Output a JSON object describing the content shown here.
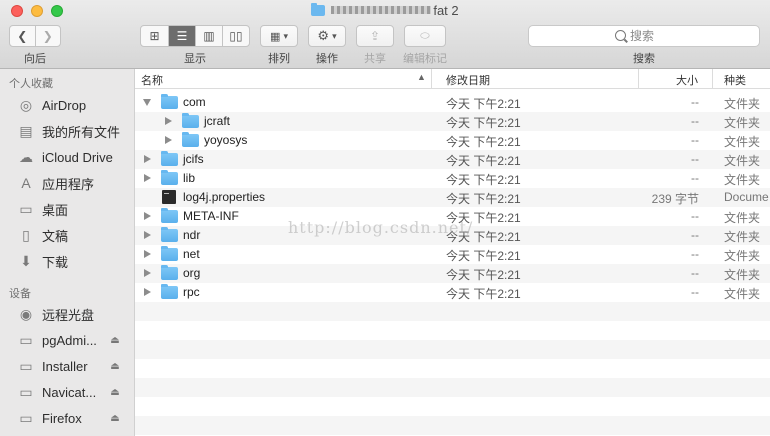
{
  "window": {
    "title": "fat 2"
  },
  "toolbar": {
    "back_forward_label": "向后",
    "view_label": "显示",
    "arrange_label": "排列",
    "action_label": "操作",
    "share_label": "共享",
    "tags_label": "编辑标记",
    "search_label": "搜索",
    "search_placeholder": "搜索"
  },
  "sidebar": {
    "favorites_heading": "个人收藏",
    "favorites": [
      {
        "label": "AirDrop",
        "icon": "airdrop-icon"
      },
      {
        "label": "我的所有文件",
        "icon": "all-files-icon"
      },
      {
        "label": "iCloud Drive",
        "icon": "cloud-icon"
      },
      {
        "label": "应用程序",
        "icon": "applications-icon"
      },
      {
        "label": "桌面",
        "icon": "desktop-icon"
      },
      {
        "label": "文稿",
        "icon": "documents-icon"
      },
      {
        "label": "下载",
        "icon": "download-icon"
      }
    ],
    "devices_heading": "设备",
    "devices": [
      {
        "label": "远程光盘",
        "icon": "remote-disc-icon"
      },
      {
        "label": "pgAdmi...",
        "icon": "drive-icon"
      },
      {
        "label": "Installer",
        "icon": "drive-icon"
      },
      {
        "label": "Navicat...",
        "icon": "drive-icon"
      },
      {
        "label": "Firefox",
        "icon": "drive-icon"
      }
    ]
  },
  "columns": {
    "name": "名称",
    "date": "修改日期",
    "size": "大小",
    "kind": "种类"
  },
  "files": [
    {
      "name": "com",
      "date": "今天 下午2:21",
      "size": "--",
      "kind": "文件夹"
    },
    {
      "name": "jcraft",
      "date": "今天 下午2:21",
      "size": "--",
      "kind": "文件夹"
    },
    {
      "name": "yoyosys",
      "date": "今天 下午2:21",
      "size": "--",
      "kind": "文件夹"
    },
    {
      "name": "jcifs",
      "date": "今天 下午2:21",
      "size": "--",
      "kind": "文件夹"
    },
    {
      "name": "lib",
      "date": "今天 下午2:21",
      "size": "--",
      "kind": "文件夹"
    },
    {
      "name": "log4j.properties",
      "date": "今天 下午2:21",
      "size": "239 字节",
      "kind": "Docume"
    },
    {
      "name": "META-INF",
      "date": "今天 下午2:21",
      "size": "--",
      "kind": "文件夹"
    },
    {
      "name": "ndr",
      "date": "今天 下午2:21",
      "size": "--",
      "kind": "文件夹"
    },
    {
      "name": "net",
      "date": "今天 下午2:21",
      "size": "--",
      "kind": "文件夹"
    },
    {
      "name": "org",
      "date": "今天 下午2:21",
      "size": "--",
      "kind": "文件夹"
    },
    {
      "name": "rpc",
      "date": "今天 下午2:21",
      "size": "--",
      "kind": "文件夹"
    }
  ],
  "watermark": "http://blog.csdn.net/"
}
